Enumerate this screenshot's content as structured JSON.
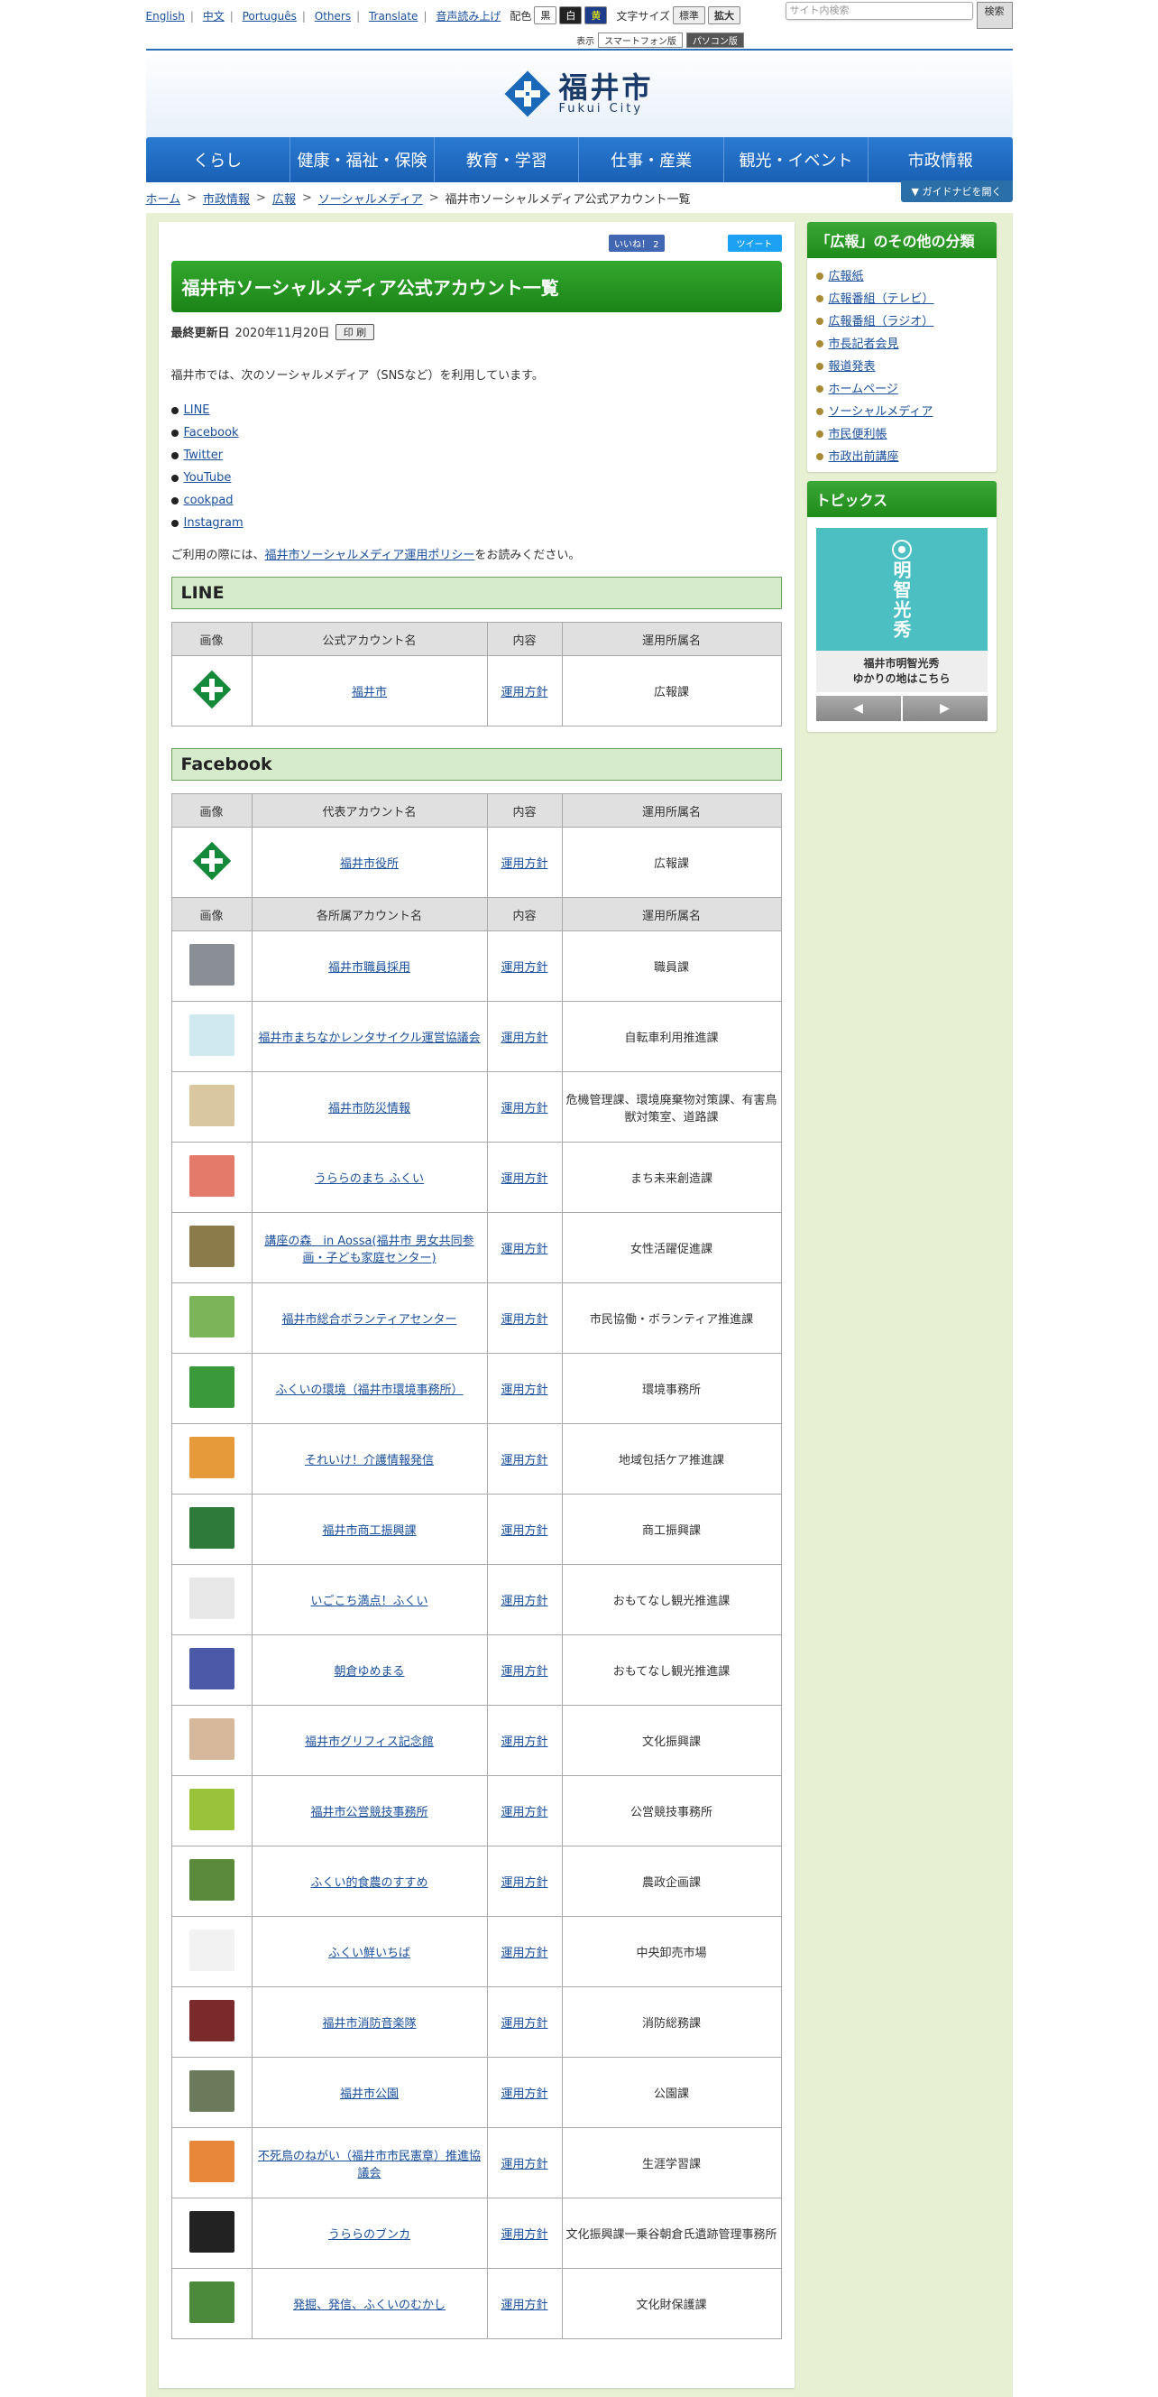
{
  "util": {
    "langs": [
      "English",
      "中文",
      "Português",
      "Others",
      "Translate",
      "音声読み上げ"
    ],
    "color_label": "配色",
    "color_black": "黒",
    "color_white": "白",
    "color_yellow": "黄",
    "font_label": "文字サイズ",
    "font_normal": "標準",
    "font_large": "拡大",
    "search_placeholder": "サイト内検索",
    "search_button": "検索",
    "display_label": "表示",
    "display_sp": "スマートフォン版",
    "display_pc": "パソコン版"
  },
  "header": {
    "logo_jp": "福井市",
    "logo_en": "Fukui City"
  },
  "nav": [
    "くらし",
    "健康・福祉・保険",
    "教育・学習",
    "仕事・産業",
    "観光・イベント",
    "市政情報"
  ],
  "breadcrumb": [
    "ホーム",
    "市政情報",
    "広報",
    "ソーシャルメディア"
  ],
  "breadcrumb_current": "福井市ソーシャルメディア公式アカウント一覧",
  "guide_button": "▼ ガイドナビを開く",
  "social": {
    "like": "いいね！ 2",
    "tweet": "ツイート"
  },
  "page": {
    "title": "福井市ソーシャルメディア公式アカウント一覧",
    "updated_label": "最終更新日",
    "updated_date": "2020年11月20日",
    "print": "印 刷",
    "intro": "福井市では、次のソーシャルメディア（SNSなど）を利用しています。",
    "sns": [
      "LINE",
      "Facebook",
      "Twitter",
      "YouTube",
      "cookpad",
      "Instagram"
    ],
    "policy_pre": "ご利用の際には、",
    "policy_link": "福井市ソーシャルメディア運用ポリシー",
    "policy_post": "をお読みください。"
  },
  "line": {
    "heading": "LINE",
    "cols": [
      "画像",
      "公式アカウント名",
      "内容",
      "運用所属名"
    ],
    "row": {
      "name": "福井市",
      "content": "運用方針",
      "dept": "広報課"
    }
  },
  "facebook": {
    "heading": "Facebook",
    "cols_main": [
      "画像",
      "代表アカウント名",
      "内容",
      "運用所属名"
    ],
    "main_row": {
      "name": "福井市役所",
      "content": "運用方針",
      "dept": "広報課"
    },
    "cols_sub": [
      "画像",
      "各所属アカウント名",
      "内容",
      "運用所属名"
    ],
    "rows": [
      {
        "name": "福井市職員採用",
        "content": "運用方針",
        "dept": "職員課",
        "color": "#8a8f95"
      },
      {
        "name": "福井市まちなかレンタサイクル運営協議会",
        "content": "運用方針",
        "dept": "自転車利用推進課",
        "color": "#cfe9f1"
      },
      {
        "name": "福井市防災情報",
        "content": "運用方針",
        "dept": "危機管理課、環境廃棄物対策課、有害鳥獣対策室、道路課",
        "color": "#d9c7a0"
      },
      {
        "name": "うららのまち ふくい",
        "content": "運用方針",
        "dept": "まち未来創造課",
        "color": "#e47a6a"
      },
      {
        "name": "講座の森　in Aossa(福井市 男女共同参画・子ども家庭センター)",
        "content": "運用方針",
        "dept": "女性活躍促進課",
        "color": "#8b7a4a"
      },
      {
        "name": "福井市総合ボランティアセンター",
        "content": "運用方針",
        "dept": "市民協働・ボランティア推進課",
        "color": "#7cb45a"
      },
      {
        "name": "ふくいの環境（福井市環境事務所）",
        "content": "運用方針",
        "dept": "環境事務所",
        "color": "#3a9a3a"
      },
      {
        "name": "それいけ！介護情報発信",
        "content": "運用方針",
        "dept": "地域包括ケア推進課",
        "color": "#e69a3a"
      },
      {
        "name": "福井市商工振興課",
        "content": "運用方針",
        "dept": "商工振興課",
        "color": "#2e7a3a"
      },
      {
        "name": "いごこち満点！ふくい",
        "content": "運用方針",
        "dept": "おもてなし観光推進課",
        "color": "#e8e8e8"
      },
      {
        "name": "朝倉ゆめまる",
        "content": "運用方針",
        "dept": "おもてなし観光推進課",
        "color": "#4a5aa8"
      },
      {
        "name": "福井市グリフィス記念館",
        "content": "運用方針",
        "dept": "文化振興課",
        "color": "#d8b89a"
      },
      {
        "name": "福井市公営競技事務所",
        "content": "運用方針",
        "dept": "公営競技事務所",
        "color": "#9ac23a"
      },
      {
        "name": "ふくい的食農のすすめ",
        "content": "運用方針",
        "dept": "農政企画課",
        "color": "#5a8a3a"
      },
      {
        "name": "ふくい鮮いちば",
        "content": "運用方針",
        "dept": "中央卸売市場",
        "color": "#f2f2f2"
      },
      {
        "name": "福井市消防音楽隊",
        "content": "運用方針",
        "dept": "消防総務課",
        "color": "#7a2a2a"
      },
      {
        "name": "福井市公園",
        "content": "運用方針",
        "dept": "公園課",
        "color": "#6a7a5a"
      },
      {
        "name": "不死鳥のねがい（福井市市民憲章）推進協議会",
        "content": "運用方針",
        "dept": "生涯学習課",
        "color": "#e8863a"
      },
      {
        "name": "うららのブンカ",
        "content": "運用方針",
        "dept": "文化振興課一乗谷朝倉氏遺跡管理事務所",
        "color": "#222222"
      },
      {
        "name": "発掘、発信、ふくいのむかし",
        "content": "運用方針",
        "dept": "文化財保護課",
        "color": "#4a8a3a"
      }
    ]
  },
  "sidebar": {
    "heading": "「広報」のその他の分類",
    "items": [
      "広報紙",
      "広報番組（テレビ）",
      "広報番組（ラジオ）",
      "市長記者会見",
      "報道発表",
      "ホームページ",
      "ソーシャルメディア",
      "市民便利帳",
      "市政出前講座"
    ],
    "topics_heading": "トピックス",
    "topic_vertical": "明智光秀",
    "topic_caption_1": "福井市明智光秀",
    "topic_caption_2": "ゆかりの地はこちら",
    "prev": "◀",
    "next": "▶"
  },
  "colors": {
    "nav": "#1f6cc4",
    "title_green": "#1b8417",
    "bg": "#e7f0d2"
  }
}
